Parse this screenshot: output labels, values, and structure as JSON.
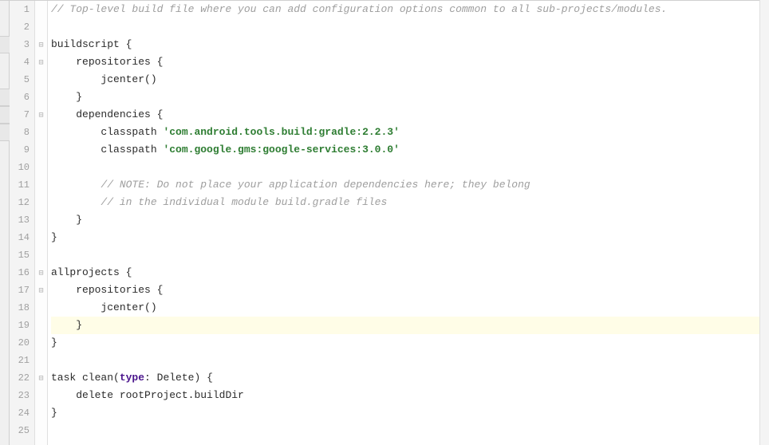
{
  "editor": {
    "highlighted_line": 19,
    "line_count": 25,
    "lines": [
      {
        "n": 1,
        "indent": 0,
        "fold": "",
        "tokens": [
          {
            "t": "// Top-level build file where you can add configuration options common to all sub-projects/modules.",
            "c": "c-comment"
          }
        ]
      },
      {
        "n": 2,
        "indent": 0,
        "fold": "",
        "tokens": []
      },
      {
        "n": 3,
        "indent": 0,
        "fold": "open",
        "tokens": [
          {
            "t": "buildscript ",
            "c": "c-plain"
          },
          {
            "t": "{",
            "c": "c-punct"
          }
        ]
      },
      {
        "n": 4,
        "indent": 1,
        "fold": "open",
        "tokens": [
          {
            "t": "repositories ",
            "c": "c-plain"
          },
          {
            "t": "{",
            "c": "c-punct"
          }
        ]
      },
      {
        "n": 5,
        "indent": 2,
        "fold": "",
        "tokens": [
          {
            "t": "jcenter()",
            "c": "c-plain"
          }
        ]
      },
      {
        "n": 6,
        "indent": 1,
        "fold": "close",
        "tokens": [
          {
            "t": "}",
            "c": "c-punct"
          }
        ]
      },
      {
        "n": 7,
        "indent": 1,
        "fold": "open",
        "tokens": [
          {
            "t": "dependencies ",
            "c": "c-plain"
          },
          {
            "t": "{",
            "c": "c-punct"
          }
        ]
      },
      {
        "n": 8,
        "indent": 2,
        "fold": "",
        "tokens": [
          {
            "t": "classpath ",
            "c": "c-plain"
          },
          {
            "t": "'com.android.tools.build:gradle:2.2.3'",
            "c": "c-string"
          }
        ]
      },
      {
        "n": 9,
        "indent": 2,
        "fold": "",
        "tokens": [
          {
            "t": "classpath ",
            "c": "c-plain"
          },
          {
            "t": "'com.google.gms:google-services:3.0.0'",
            "c": "c-string"
          }
        ]
      },
      {
        "n": 10,
        "indent": 0,
        "fold": "",
        "tokens": []
      },
      {
        "n": 11,
        "indent": 2,
        "fold": "",
        "tokens": [
          {
            "t": "// NOTE: Do not place your application dependencies here; they belong",
            "c": "c-comment"
          }
        ]
      },
      {
        "n": 12,
        "indent": 2,
        "fold": "",
        "tokens": [
          {
            "t": "// in the individual module build.gradle files",
            "c": "c-comment"
          }
        ]
      },
      {
        "n": 13,
        "indent": 1,
        "fold": "close",
        "tokens": [
          {
            "t": "}",
            "c": "c-punct"
          }
        ]
      },
      {
        "n": 14,
        "indent": 0,
        "fold": "close",
        "tokens": [
          {
            "t": "}",
            "c": "c-punct"
          }
        ]
      },
      {
        "n": 15,
        "indent": 0,
        "fold": "",
        "tokens": []
      },
      {
        "n": 16,
        "indent": 0,
        "fold": "open",
        "tokens": [
          {
            "t": "allprojects ",
            "c": "c-plain"
          },
          {
            "t": "{",
            "c": "c-punct"
          }
        ]
      },
      {
        "n": 17,
        "indent": 1,
        "fold": "open",
        "tokens": [
          {
            "t": "repositories ",
            "c": "c-plain"
          },
          {
            "t": "{",
            "c": "c-punct"
          }
        ]
      },
      {
        "n": 18,
        "indent": 2,
        "fold": "",
        "tokens": [
          {
            "t": "jcenter()",
            "c": "c-plain"
          }
        ]
      },
      {
        "n": 19,
        "indent": 1,
        "fold": "close",
        "tokens": [
          {
            "t": "}",
            "c": "c-punct"
          }
        ]
      },
      {
        "n": 20,
        "indent": 0,
        "fold": "close",
        "tokens": [
          {
            "t": "}",
            "c": "c-punct"
          }
        ]
      },
      {
        "n": 21,
        "indent": 0,
        "fold": "",
        "tokens": []
      },
      {
        "n": 22,
        "indent": 0,
        "fold": "open",
        "tokens": [
          {
            "t": "task clean(",
            "c": "c-plain"
          },
          {
            "t": "type",
            "c": "c-named"
          },
          {
            "t": ": Delete) ",
            "c": "c-plain"
          },
          {
            "t": "{",
            "c": "c-punct"
          }
        ]
      },
      {
        "n": 23,
        "indent": 1,
        "fold": "",
        "tokens": [
          {
            "t": "delete rootProject.buildDir",
            "c": "c-plain"
          }
        ]
      },
      {
        "n": 24,
        "indent": 0,
        "fold": "close",
        "tokens": [
          {
            "t": "}",
            "c": "c-punct"
          }
        ]
      },
      {
        "n": 25,
        "indent": 0,
        "fold": "",
        "tokens": []
      }
    ]
  }
}
